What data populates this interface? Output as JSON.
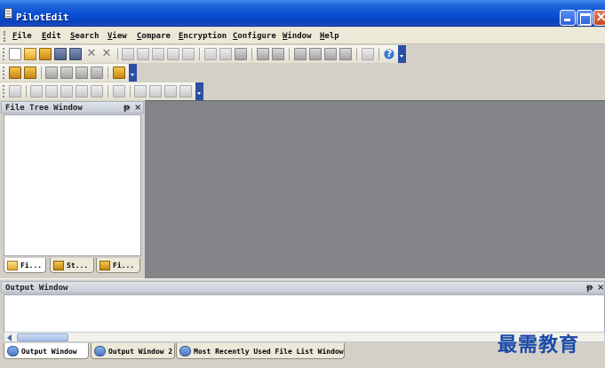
{
  "window": {
    "title": "PilotEdit"
  },
  "menu": [
    "File",
    "Edit",
    "Search",
    "View",
    "Compare",
    "Encryption",
    "Configure",
    "Window",
    "Help"
  ],
  "file_tree": {
    "title": "File Tree Window",
    "pin": "ᵽ",
    "close": "×",
    "tabs": [
      "Fi...",
      "St...",
      "Fi..."
    ]
  },
  "output": {
    "title": "Output Window",
    "pin": "ᵽ",
    "close": "×"
  },
  "bottom_tabs": [
    "Output Window",
    "Output Window 2",
    "Most Recently Used File List Window"
  ],
  "watermark": "最需教育"
}
